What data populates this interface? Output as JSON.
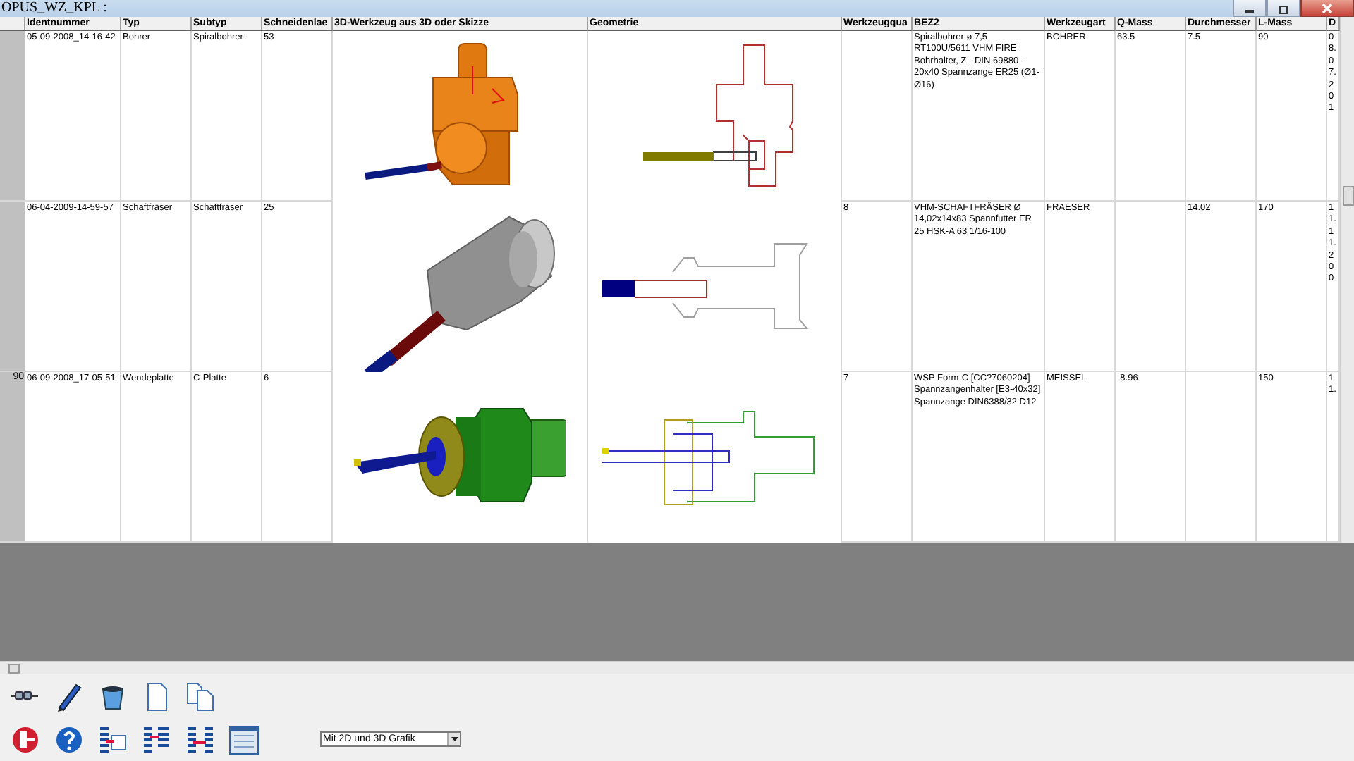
{
  "window": {
    "title": "OPUS_WZ_KPL :"
  },
  "table": {
    "columns": [
      "Identnummer",
      "Typ",
      "Subtyp",
      "Schneidenlae",
      "3D-Werkzeug aus 3D oder Skizze",
      "Geometrie",
      "Werkzeugqua",
      "BEZ2",
      "Werkzeugart",
      "Q-Mass",
      "Durchmesser",
      "L-Mass",
      "D"
    ],
    "rows": [
      {
        "row_header": "",
        "kind": "drill-holder",
        "ident": "05-09-2008_14-16-42",
        "typ": "Bohrer",
        "subtyp": "Spiralbohrer",
        "schneiden": "53",
        "werkzeugqua": "",
        "bez2": "Spiralbohrer ø 7,5 RT100U/5611 VHM FIRE Bohrhalter, Z - DIN 69880 - 20x40 Spannzange ER25 (Ø1-Ø16)",
        "art": "BOHRER",
        "q_mass": "63.5",
        "durchmesser": "7.5",
        "l_mass": "90",
        "d": "0\n8.\n0\n7.\n2\n0\n1"
      },
      {
        "row_header": "",
        "kind": "end-mill-holder",
        "ident": "06-04-2009-14-59-57",
        "typ": "Schaftfräser",
        "subtyp": "Schaftfräser",
        "schneiden": "25",
        "werkzeugqua": "8",
        "bez2": "VHM-SCHAFTFRÄSER Ø 14,02x14x83 Spannfutter ER 25 HSK-A 63 1/16-100",
        "art": "FRAESER",
        "q_mass": "",
        "durchmesser": "14.02",
        "l_mass": "170",
        "d": "1\n1.\n1\n1.\n2\n0\n0"
      },
      {
        "row_header": "90",
        "kind": "turning-holder",
        "ident": "06-09-2008_17-05-51",
        "typ": "Wendeplatte",
        "subtyp": "C-Platte",
        "schneiden": "6",
        "werkzeugqua": "7",
        "bez2": "WSP Form-C [CC?7060204] Spannzangenhalter [E3-40x32] Spannzange DIN6388/32 D12",
        "art": "MEISSEL",
        "q_mass": "-8.96",
        "durchmesser": "",
        "l_mass": "150",
        "d": "1\n1."
      }
    ]
  },
  "toolbar": {
    "view_select": {
      "value": "Mit 2D und 3D Grafik"
    }
  }
}
